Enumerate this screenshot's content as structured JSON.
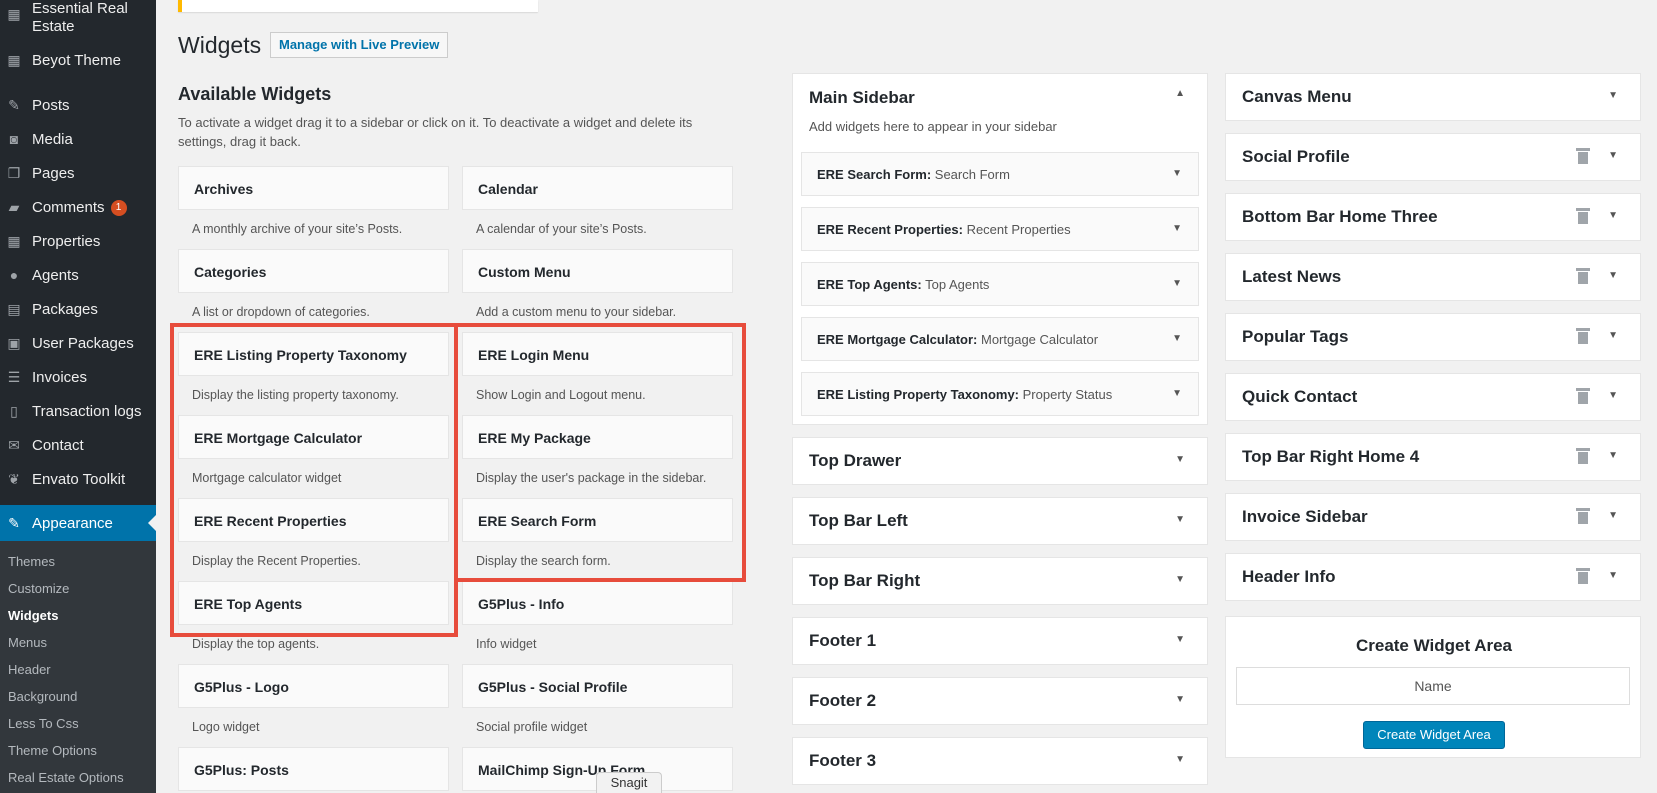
{
  "sidebar": {
    "items": [
      {
        "label": "Essential Real Estate",
        "icon": "building-icon"
      },
      {
        "label": "Beyot Theme",
        "icon": "grid-icon"
      },
      {
        "label": "Posts",
        "icon": "pin-icon"
      },
      {
        "label": "Media",
        "icon": "media-icon"
      },
      {
        "label": "Pages",
        "icon": "pages-icon"
      },
      {
        "label": "Comments",
        "icon": "comment-icon",
        "badge": "1"
      },
      {
        "label": "Properties",
        "icon": "building-icon"
      },
      {
        "label": "Agents",
        "icon": "person-icon"
      },
      {
        "label": "Packages",
        "icon": "table-icon"
      },
      {
        "label": "User Packages",
        "icon": "id-card-icon"
      },
      {
        "label": "Invoices",
        "icon": "list-icon"
      },
      {
        "label": "Transaction logs",
        "icon": "document-icon"
      },
      {
        "label": "Contact",
        "icon": "mail-icon"
      },
      {
        "label": "Envato Toolkit",
        "icon": "leaf-icon"
      }
    ],
    "current": {
      "label": "Appearance",
      "icon": "paintbrush-icon"
    },
    "submenu": [
      "Themes",
      "Customize",
      "Widgets",
      "Menus",
      "Header",
      "Background",
      "Less To Css",
      "Theme Options",
      "Real Estate Options"
    ]
  },
  "header": {
    "title": "Widgets",
    "live_preview": "Manage with Live Preview"
  },
  "available": {
    "title": "Available Widgets",
    "description": "To activate a widget drag it to a sidebar or click on it. To deactivate a widget and delete its settings, drag it back.",
    "left": [
      {
        "name": "Archives",
        "desc": "A monthly archive of your site’s Posts."
      },
      {
        "name": "Categories",
        "desc": "A list or dropdown of categories."
      },
      {
        "name": "ERE Listing Property Taxonomy",
        "desc": "Display the listing property taxonomy."
      },
      {
        "name": "ERE Mortgage Calculator",
        "desc": "Mortgage calculator widget"
      },
      {
        "name": "ERE Recent Properties",
        "desc": "Display the Recent Properties."
      },
      {
        "name": "ERE Top Agents",
        "desc": "Display the top agents."
      },
      {
        "name": "G5Plus - Logo",
        "desc": "Logo widget"
      },
      {
        "name": "G5Plus: Posts",
        "desc": ""
      }
    ],
    "right": [
      {
        "name": "Calendar",
        "desc": "A calendar of your site’s Posts."
      },
      {
        "name": "Custom Menu",
        "desc": "Add a custom menu to your sidebar."
      },
      {
        "name": "ERE Login Menu",
        "desc": "Show Login and Logout menu."
      },
      {
        "name": "ERE My Package",
        "desc": "Display the user's package in the sidebar."
      },
      {
        "name": "ERE Search Form",
        "desc": "Display the search form."
      },
      {
        "name": "G5Plus - Info",
        "desc": "Info widget"
      },
      {
        "name": "G5Plus - Social Profile",
        "desc": "Social profile widget"
      },
      {
        "name": "MailChimp Sign-Up Form",
        "desc": ""
      }
    ]
  },
  "main_sidebar": {
    "title": "Main Sidebar",
    "description": "Add widgets here to appear in your sidebar",
    "widgets": [
      {
        "name": "ERE Search Form:",
        "title": "Search Form"
      },
      {
        "name": "ERE Recent Properties:",
        "title": "Recent Properties"
      },
      {
        "name": "ERE Top Agents:",
        "title": "Top Agents"
      },
      {
        "name": "ERE Mortgage Calculator:",
        "title": "Mortgage Calculator"
      },
      {
        "name": "ERE Listing Property Taxonomy:",
        "title": "Property Status"
      }
    ]
  },
  "middle_areas": [
    "Top Drawer",
    "Top Bar Left",
    "Top Bar Right",
    "Footer 1",
    "Footer 2",
    "Footer 3"
  ],
  "right_areas": [
    "Canvas Menu",
    "Social Profile",
    "Bottom Bar Home Three",
    "Latest News",
    "Popular Tags",
    "Quick Contact",
    "Top Bar Right Home 4",
    "Invoice Sidebar",
    "Header Info"
  ],
  "create_area": {
    "title": "Create Widget Area",
    "placeholder": "Name",
    "button": "Create Widget Area"
  },
  "snagit": "Snagit",
  "colors": {
    "admin_bar": "#23282d",
    "submenu_bg": "#32373c",
    "accent": "#0073aa",
    "highlight_box": "#e74c3c",
    "button": "#0085ba",
    "badge": "#d54e21"
  }
}
